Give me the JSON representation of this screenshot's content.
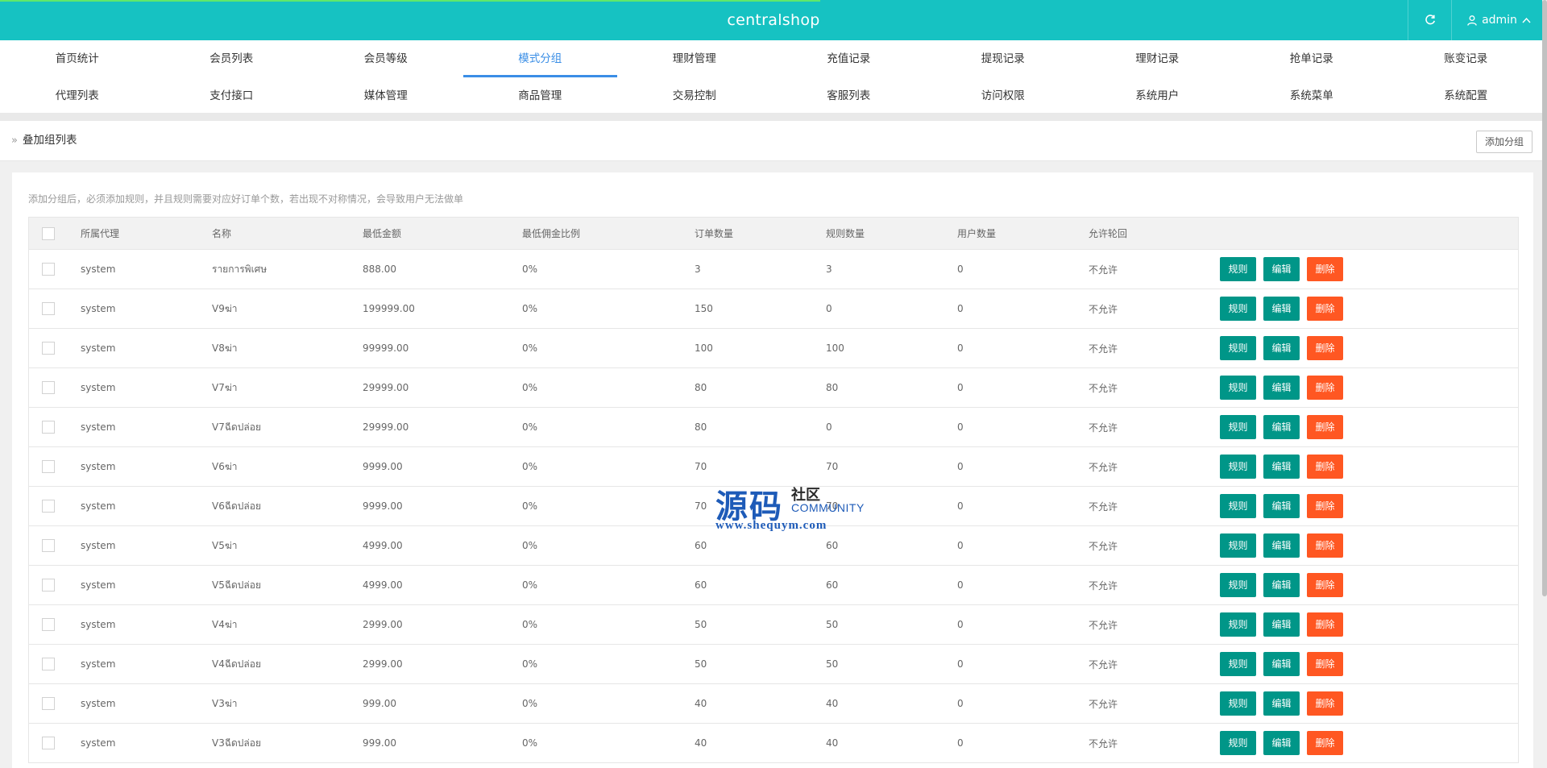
{
  "app": {
    "title": "centralshop",
    "user_label": "admin",
    "accent_color": "#16c2c2",
    "icons": {
      "refresh": "refresh-icon",
      "user": "user-icon",
      "caret": "chevron-up-icon"
    }
  },
  "nav": {
    "row1": [
      "首页统计",
      "会员列表",
      "会员等级",
      "模式分组",
      "理财管理",
      "充值记录",
      "提现记录",
      "理财记录",
      "抢单记录",
      "账变记录"
    ],
    "row2": [
      "代理列表",
      "支付接口",
      "媒体管理",
      "商品管理",
      "交易控制",
      "客服列表",
      "访问权限",
      "系统用户",
      "系统菜单",
      "系统配置"
    ],
    "active": "模式分组"
  },
  "breadcrumb": {
    "label": "叠加组列表"
  },
  "toolbar": {
    "add_label": "添加分组"
  },
  "notice": "添加分组后，必须添加规则，并且规则需要对应好订单个数，若出现不对称情况，会导致用户无法做单",
  "table": {
    "columns": [
      "所属代理",
      "名称",
      "最低金额",
      "最低佣金比例",
      "订单数量",
      "规则数量",
      "用户数量",
      "允许轮回"
    ],
    "actions": {
      "rule": "规则",
      "edit": "编辑",
      "delete": "删除"
    },
    "rows": [
      {
        "agent": "system",
        "name": "รายการพิเศษ",
        "min": "888.00",
        "rate": "0%",
        "orders": "3",
        "rules": "3",
        "users": "0",
        "allow": "不允许"
      },
      {
        "agent": "system",
        "name": "V9ฆ่า",
        "min": "199999.00",
        "rate": "0%",
        "orders": "150",
        "rules": "0",
        "users": "0",
        "allow": "不允许"
      },
      {
        "agent": "system",
        "name": "V8ฆ่า",
        "min": "99999.00",
        "rate": "0%",
        "orders": "100",
        "rules": "100",
        "users": "0",
        "allow": "不允许"
      },
      {
        "agent": "system",
        "name": "V7ฆ่า",
        "min": "29999.00",
        "rate": "0%",
        "orders": "80",
        "rules": "80",
        "users": "0",
        "allow": "不允许"
      },
      {
        "agent": "system",
        "name": "V7ฉีดปล่อย",
        "min": "29999.00",
        "rate": "0%",
        "orders": "80",
        "rules": "0",
        "users": "0",
        "allow": "不允许"
      },
      {
        "agent": "system",
        "name": "V6ฆ่า",
        "min": "9999.00",
        "rate": "0%",
        "orders": "70",
        "rules": "70",
        "users": "0",
        "allow": "不允许"
      },
      {
        "agent": "system",
        "name": "V6ฉีดปล่อย",
        "min": "9999.00",
        "rate": "0%",
        "orders": "70",
        "rules": "70",
        "users": "0",
        "allow": "不允许"
      },
      {
        "agent": "system",
        "name": "V5ฆ่า",
        "min": "4999.00",
        "rate": "0%",
        "orders": "60",
        "rules": "60",
        "users": "0",
        "allow": "不允许"
      },
      {
        "agent": "system",
        "name": "V5ฉีดปล่อย",
        "min": "4999.00",
        "rate": "0%",
        "orders": "60",
        "rules": "60",
        "users": "0",
        "allow": "不允许"
      },
      {
        "agent": "system",
        "name": "V4ฆ่า",
        "min": "2999.00",
        "rate": "0%",
        "orders": "50",
        "rules": "50",
        "users": "0",
        "allow": "不允许"
      },
      {
        "agent": "system",
        "name": "V4ฉีดปล่อย",
        "min": "2999.00",
        "rate": "0%",
        "orders": "50",
        "rules": "50",
        "users": "0",
        "allow": "不允许"
      },
      {
        "agent": "system",
        "name": "V3ฆ่า",
        "min": "999.00",
        "rate": "0%",
        "orders": "40",
        "rules": "40",
        "users": "0",
        "allow": "不允许"
      },
      {
        "agent": "system",
        "name": "V3ฉีดปล่อย",
        "min": "999.00",
        "rate": "0%",
        "orders": "40",
        "rules": "40",
        "users": "0",
        "allow": "不允许"
      }
    ]
  },
  "watermark": {
    "big": "源码",
    "small1": "社区",
    "small2": "COMMUNITY",
    "url": "www.shequym.com"
  }
}
